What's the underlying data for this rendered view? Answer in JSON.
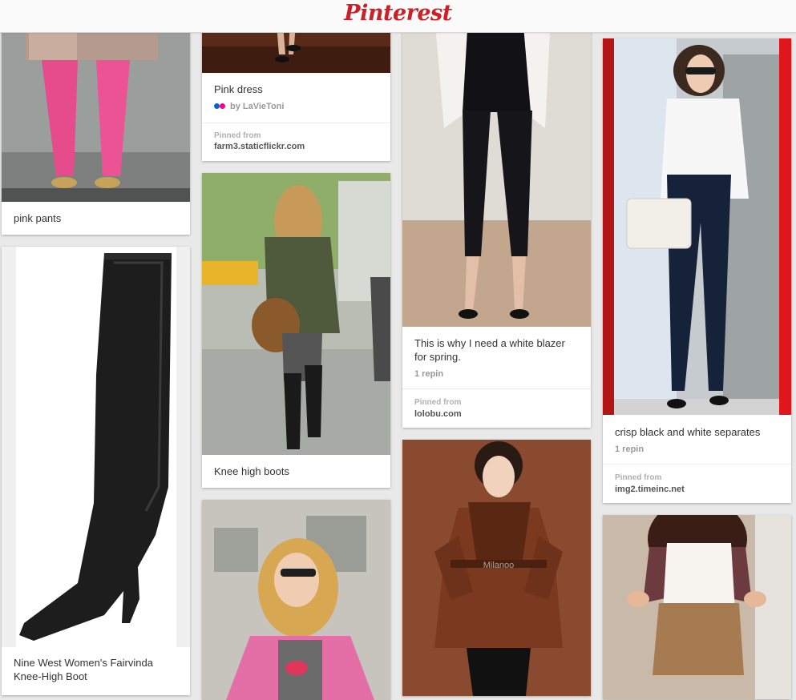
{
  "header": {
    "logo": "Pinterest"
  },
  "pins": {
    "pink_pants": {
      "description": "pink pants"
    },
    "pink_dress": {
      "description": "Pink dress",
      "by": "by LaVieToni",
      "pinned_from_label": "Pinned from",
      "source": "farm3.staticflickr.com"
    },
    "boot": {
      "description": "Nine West Women's Fairvinda Knee-High Boot"
    },
    "knee_boots": {
      "description": "Knee high boots"
    },
    "blazer": {
      "description": "This is why I need a white blazer for spring.",
      "repins": "1 repin",
      "pinned_from_label": "Pinned from",
      "source": "lolobu.com"
    },
    "separates": {
      "description": "crisp black and white separates",
      "repins": "1 repin",
      "pinned_from_label": "Pinned from",
      "source": "img2.timeinc.net"
    }
  },
  "image_watermarks": {
    "leather_coat": "Milanoo"
  },
  "colors": {
    "brand": "#cb2027",
    "background": "#e9e9e9",
    "flickr_blue": "#0063dc",
    "flickr_pink": "#ff0084"
  }
}
